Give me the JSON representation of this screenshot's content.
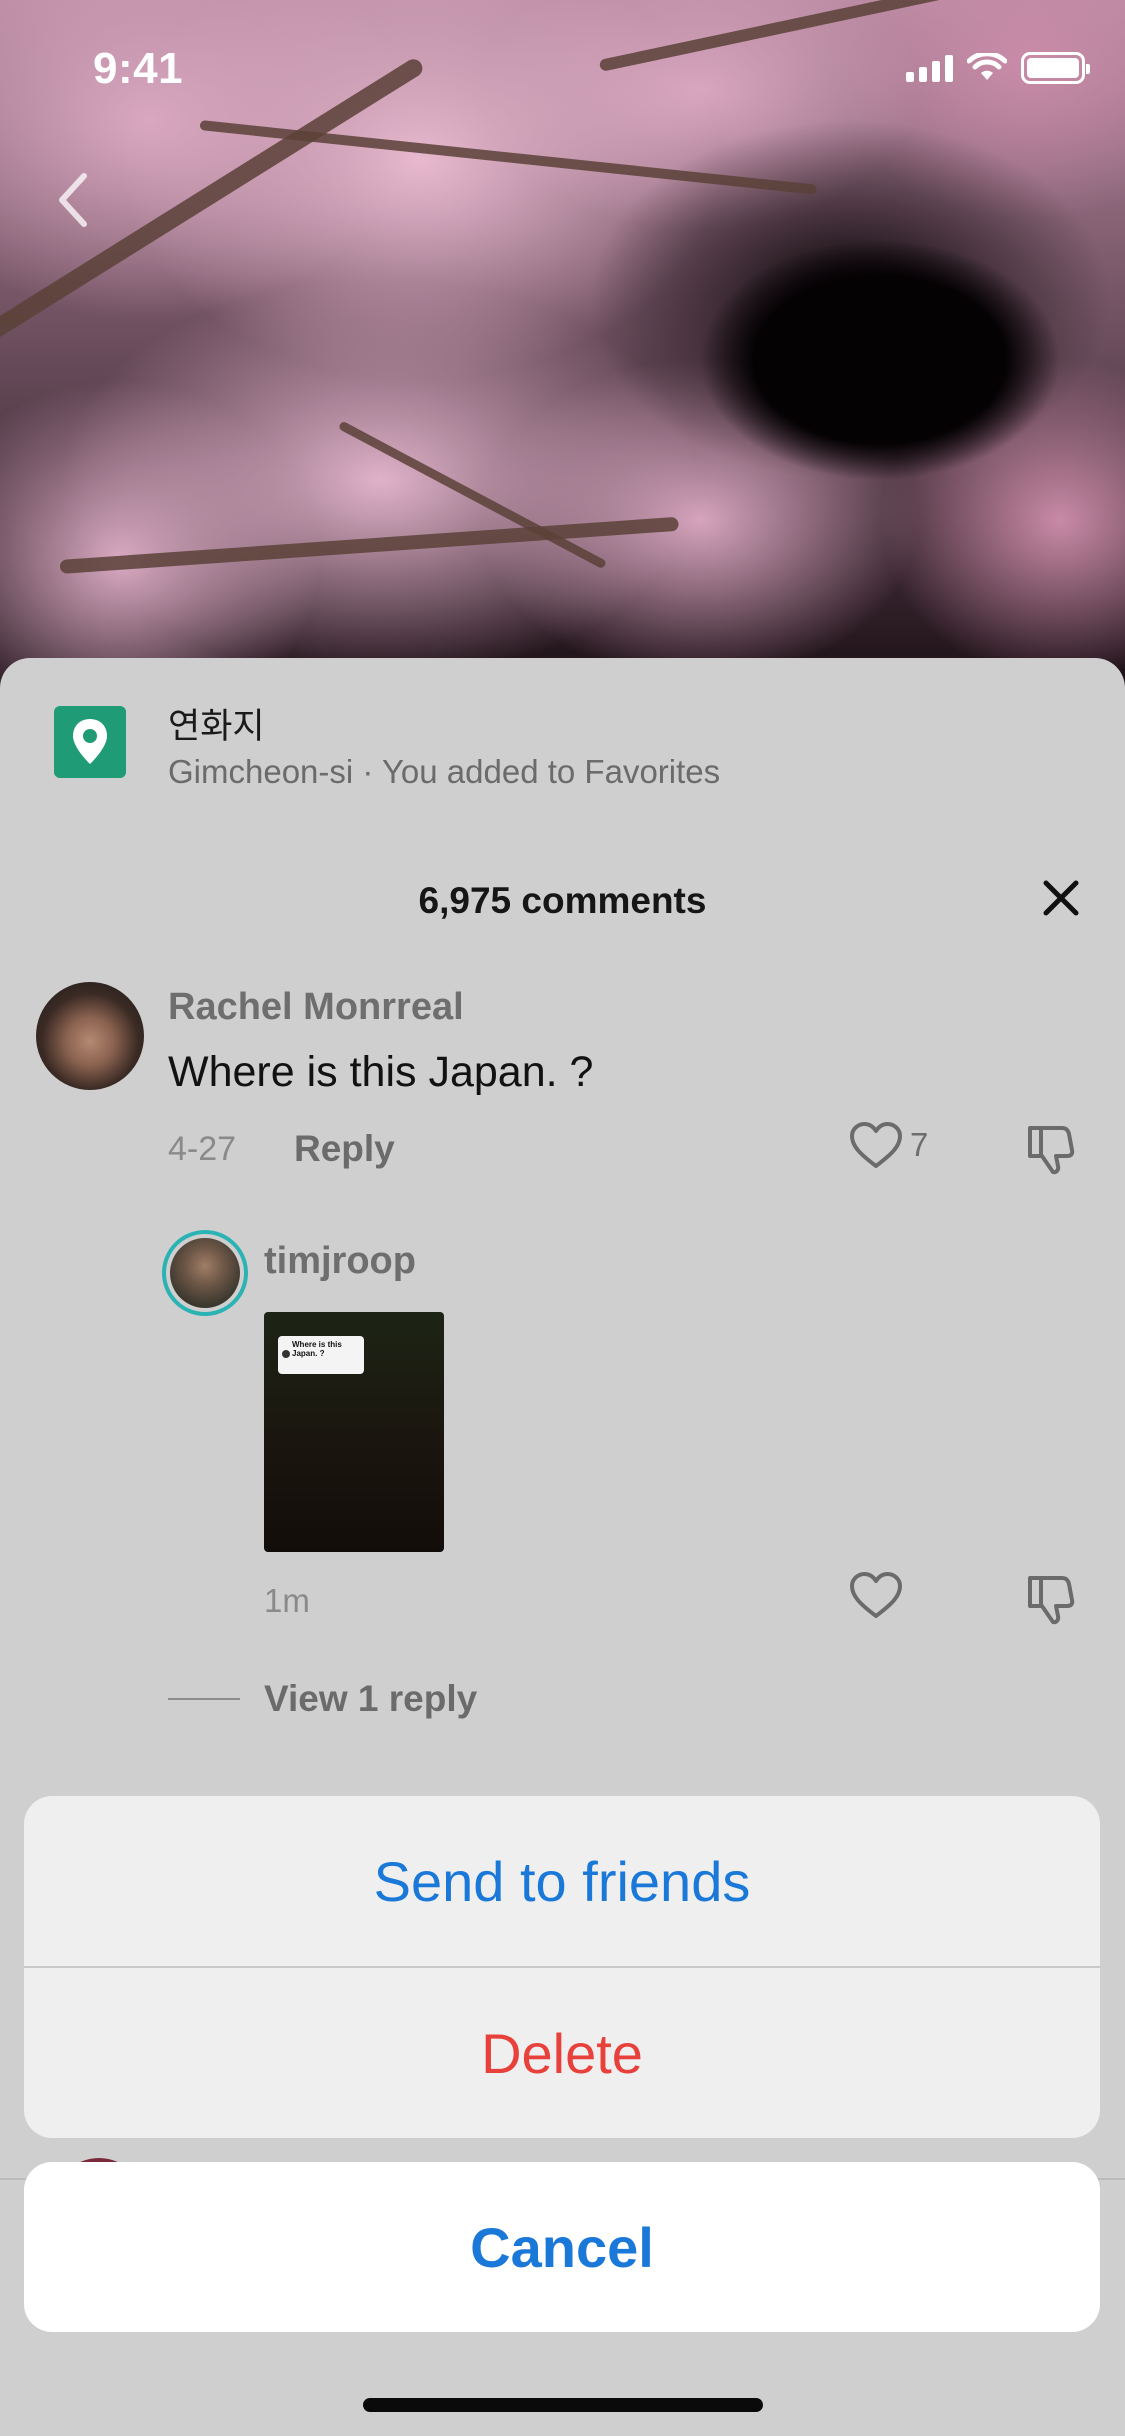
{
  "status_bar": {
    "time": "9:41"
  },
  "place": {
    "name": "연화지",
    "subtitle": "Gimcheon-si · You added to Favorites"
  },
  "comments_header": {
    "count_label": "6,975 comments"
  },
  "comment": {
    "author": "Rachel Monrreal",
    "text": "Where is this Japan. ?",
    "date": "4-27",
    "reply_label": "Reply",
    "like_count": "7"
  },
  "video_reply": {
    "author": "timjroop",
    "thumb_caption": "Where is this Japan. ?",
    "time": "1m"
  },
  "view_replies_label": "View 1 reply",
  "action_sheet": {
    "send_label": "Send to friends",
    "delete_label": "Delete",
    "cancel_label": "Cancel"
  },
  "colors": {
    "accent_blue": "#1a78d8",
    "destructive_red": "#e8403a",
    "place_pin_green": "#1f9b75"
  }
}
